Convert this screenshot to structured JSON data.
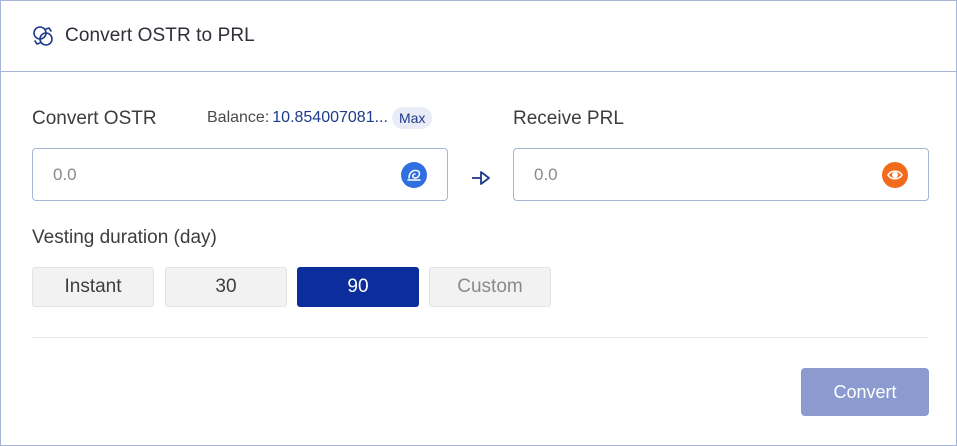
{
  "header": {
    "title": "Convert OSTR to PRL",
    "icon": "swap-circles-icon"
  },
  "from": {
    "label": "Convert OSTR",
    "balance_label": "Balance:",
    "balance_value": "10.854007081...",
    "max_label": "Max",
    "placeholder": "0.0",
    "token_icon": "ostr-token-icon",
    "token_color": "#2f6fe0"
  },
  "to": {
    "label": "Receive PRL",
    "placeholder": "0.0",
    "token_icon": "prl-token-icon",
    "token_color": "#f26a1b"
  },
  "vesting": {
    "label": "Vesting duration (day)",
    "options": [
      "Instant",
      "30",
      "90",
      "Custom"
    ],
    "selected": "90"
  },
  "actions": {
    "convert_label": "Convert"
  },
  "colors": {
    "accent": "#0c2d9c",
    "border": "#a9b5d6",
    "button_disabled": "#8b9bd0"
  }
}
